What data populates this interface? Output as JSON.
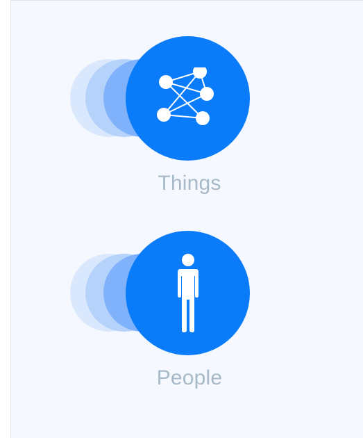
{
  "items": [
    {
      "label": "Things",
      "icon": "network-graph-icon"
    },
    {
      "label": "People",
      "icon": "person-icon"
    }
  ],
  "colors": {
    "panel_background": "#f5f9ff",
    "circle": "#0a7cf9",
    "ghost_1": "#d9e8fd",
    "ghost_2": "#b5d2fb",
    "ghost_3": "#7fb2fa",
    "label": "#a7b9c8"
  }
}
